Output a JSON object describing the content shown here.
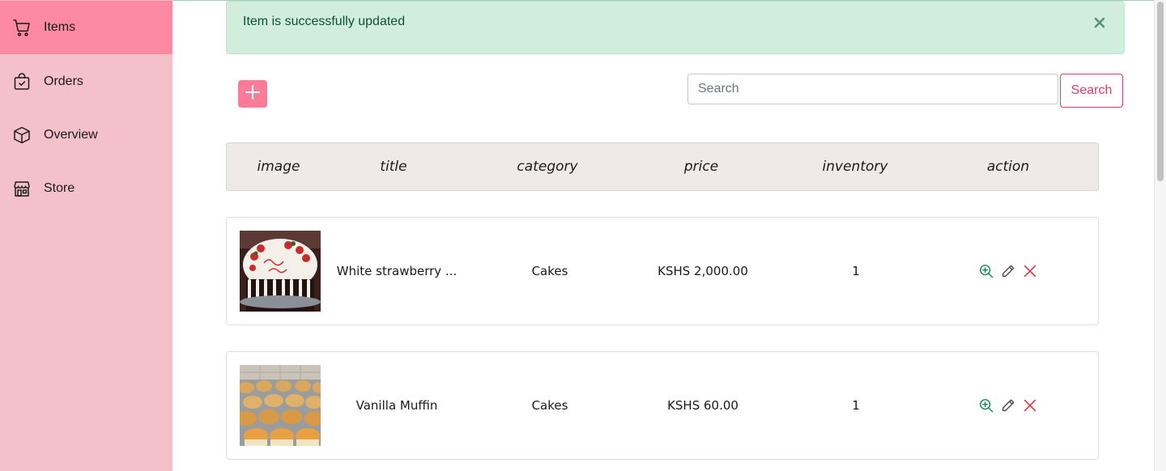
{
  "sidebar": {
    "items": [
      {
        "label": "Items",
        "icon": "cart-icon",
        "active": true
      },
      {
        "label": "Orders",
        "icon": "shopping-bag-check-icon",
        "active": false
      },
      {
        "label": "Overview",
        "icon": "box-icon",
        "active": false
      },
      {
        "label": "Store",
        "icon": "shop-icon",
        "active": false
      }
    ]
  },
  "alert": {
    "message": "Item is successfully updated",
    "close_icon": "close-icon"
  },
  "toolbar": {
    "add_icon": "plus-icon",
    "search_placeholder": "Search",
    "search_value": "",
    "search_label": "Search"
  },
  "table": {
    "columns": [
      "image",
      "title",
      "category",
      "price",
      "inventory",
      "action"
    ],
    "rows": [
      {
        "image": "birthday-cake-thumbnail",
        "title": "White strawberry ...",
        "category": "Cakes",
        "price": "KSHS 2,000.00",
        "inventory": "1",
        "actions": [
          "zoom-in-icon",
          "pencil-icon",
          "delete-x-icon"
        ]
      },
      {
        "image": "muffins-thumbnail",
        "title": "Vanilla Muffin",
        "category": "Cakes",
        "price": "KSHS 60.00",
        "inventory": "1",
        "actions": [
          "zoom-in-icon",
          "pencil-icon",
          "delete-x-icon"
        ]
      }
    ]
  },
  "colors": {
    "sidebar_bg": "#f4c1cb",
    "sidebar_active": "#fd8aa2",
    "alert_bg": "#d1eedd",
    "alert_text": "#0f5132",
    "accent": "#fd7b99",
    "search_button": "#d63f6b",
    "view_icon": "#198754",
    "delete_icon": "#dc3545"
  }
}
